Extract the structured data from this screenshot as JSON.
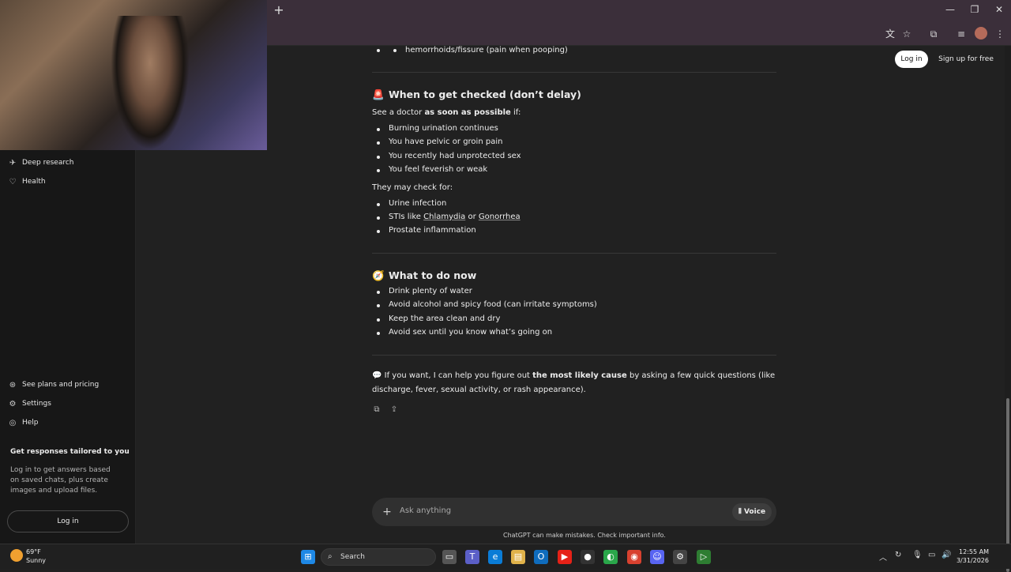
{
  "browser": {
    "new_tab": "+",
    "window_controls": {
      "minimize": "—",
      "restore": "❐",
      "close": "✕"
    },
    "toolbar_icons": [
      "translate-icon",
      "star-icon",
      "extensions-icon",
      "tab-search-icon",
      "profile-avatar",
      "menu-icon"
    ]
  },
  "sidebar": {
    "top_items": [
      {
        "label": "Deep research",
        "icon": "telescope-icon"
      },
      {
        "label": "Health",
        "icon": "heart-icon"
      }
    ],
    "bottom_items": [
      {
        "label": "See plans and pricing",
        "icon": "plans-icon"
      },
      {
        "label": "Settings",
        "icon": "gear-icon"
      },
      {
        "label": "Help",
        "icon": "help-icon"
      }
    ],
    "promo_title": "Get responses tailored to you",
    "promo_text": "Log in to get answers based on saved chats, plus create images and upload files.",
    "login_button": "Log in"
  },
  "header": {
    "login": "Log in",
    "signup": "Sign up for free"
  },
  "chat": {
    "top_item": "hemorrhoids/fissure (pain when pooping)",
    "section1": {
      "emoji": "🚨",
      "title": "When to get checked (don’t delay)",
      "intro_pre": "See a doctor ",
      "intro_bold": "as soon as possible",
      "intro_post": " if:",
      "items": [
        "Burning urination continues",
        "You have pelvic or groin pain",
        "You recently had unprotected sex",
        "You feel feverish or weak"
      ],
      "check_intro": "They may check for:",
      "check_item1": "Urine infection",
      "check_item2_pre": "STIs like ",
      "check_item2_link1": "Chlamydia",
      "check_item2_mid": " or ",
      "check_item2_link2": "Gonorrhea",
      "check_item3": "Prostate inflammation"
    },
    "section2": {
      "emoji": "🧭",
      "title": "What to do now",
      "items": [
        "Drink plenty of water",
        "Avoid alcohol and spicy food (can irritate symptoms)",
        "Keep the area clean and dry",
        "Avoid sex until you know what’s going on"
      ]
    },
    "closing": {
      "emoji": "💬",
      "pre": " If you want, I can help you figure out ",
      "bold": "the most likely cause",
      "post": " by asking a few quick questions (like",
      "line2": "discharge, fever, sexual activity, or rash appearance)."
    }
  },
  "composer": {
    "placeholder": "Ask anything",
    "voice": "Voice"
  },
  "disclaimer": "ChatGPT can make mistakes. Check important info.",
  "taskbar": {
    "weather_temp": "69°F",
    "weather_cond": "Sunny",
    "search": "Search",
    "time": "12:55 AM",
    "date": "3/31/2026"
  }
}
